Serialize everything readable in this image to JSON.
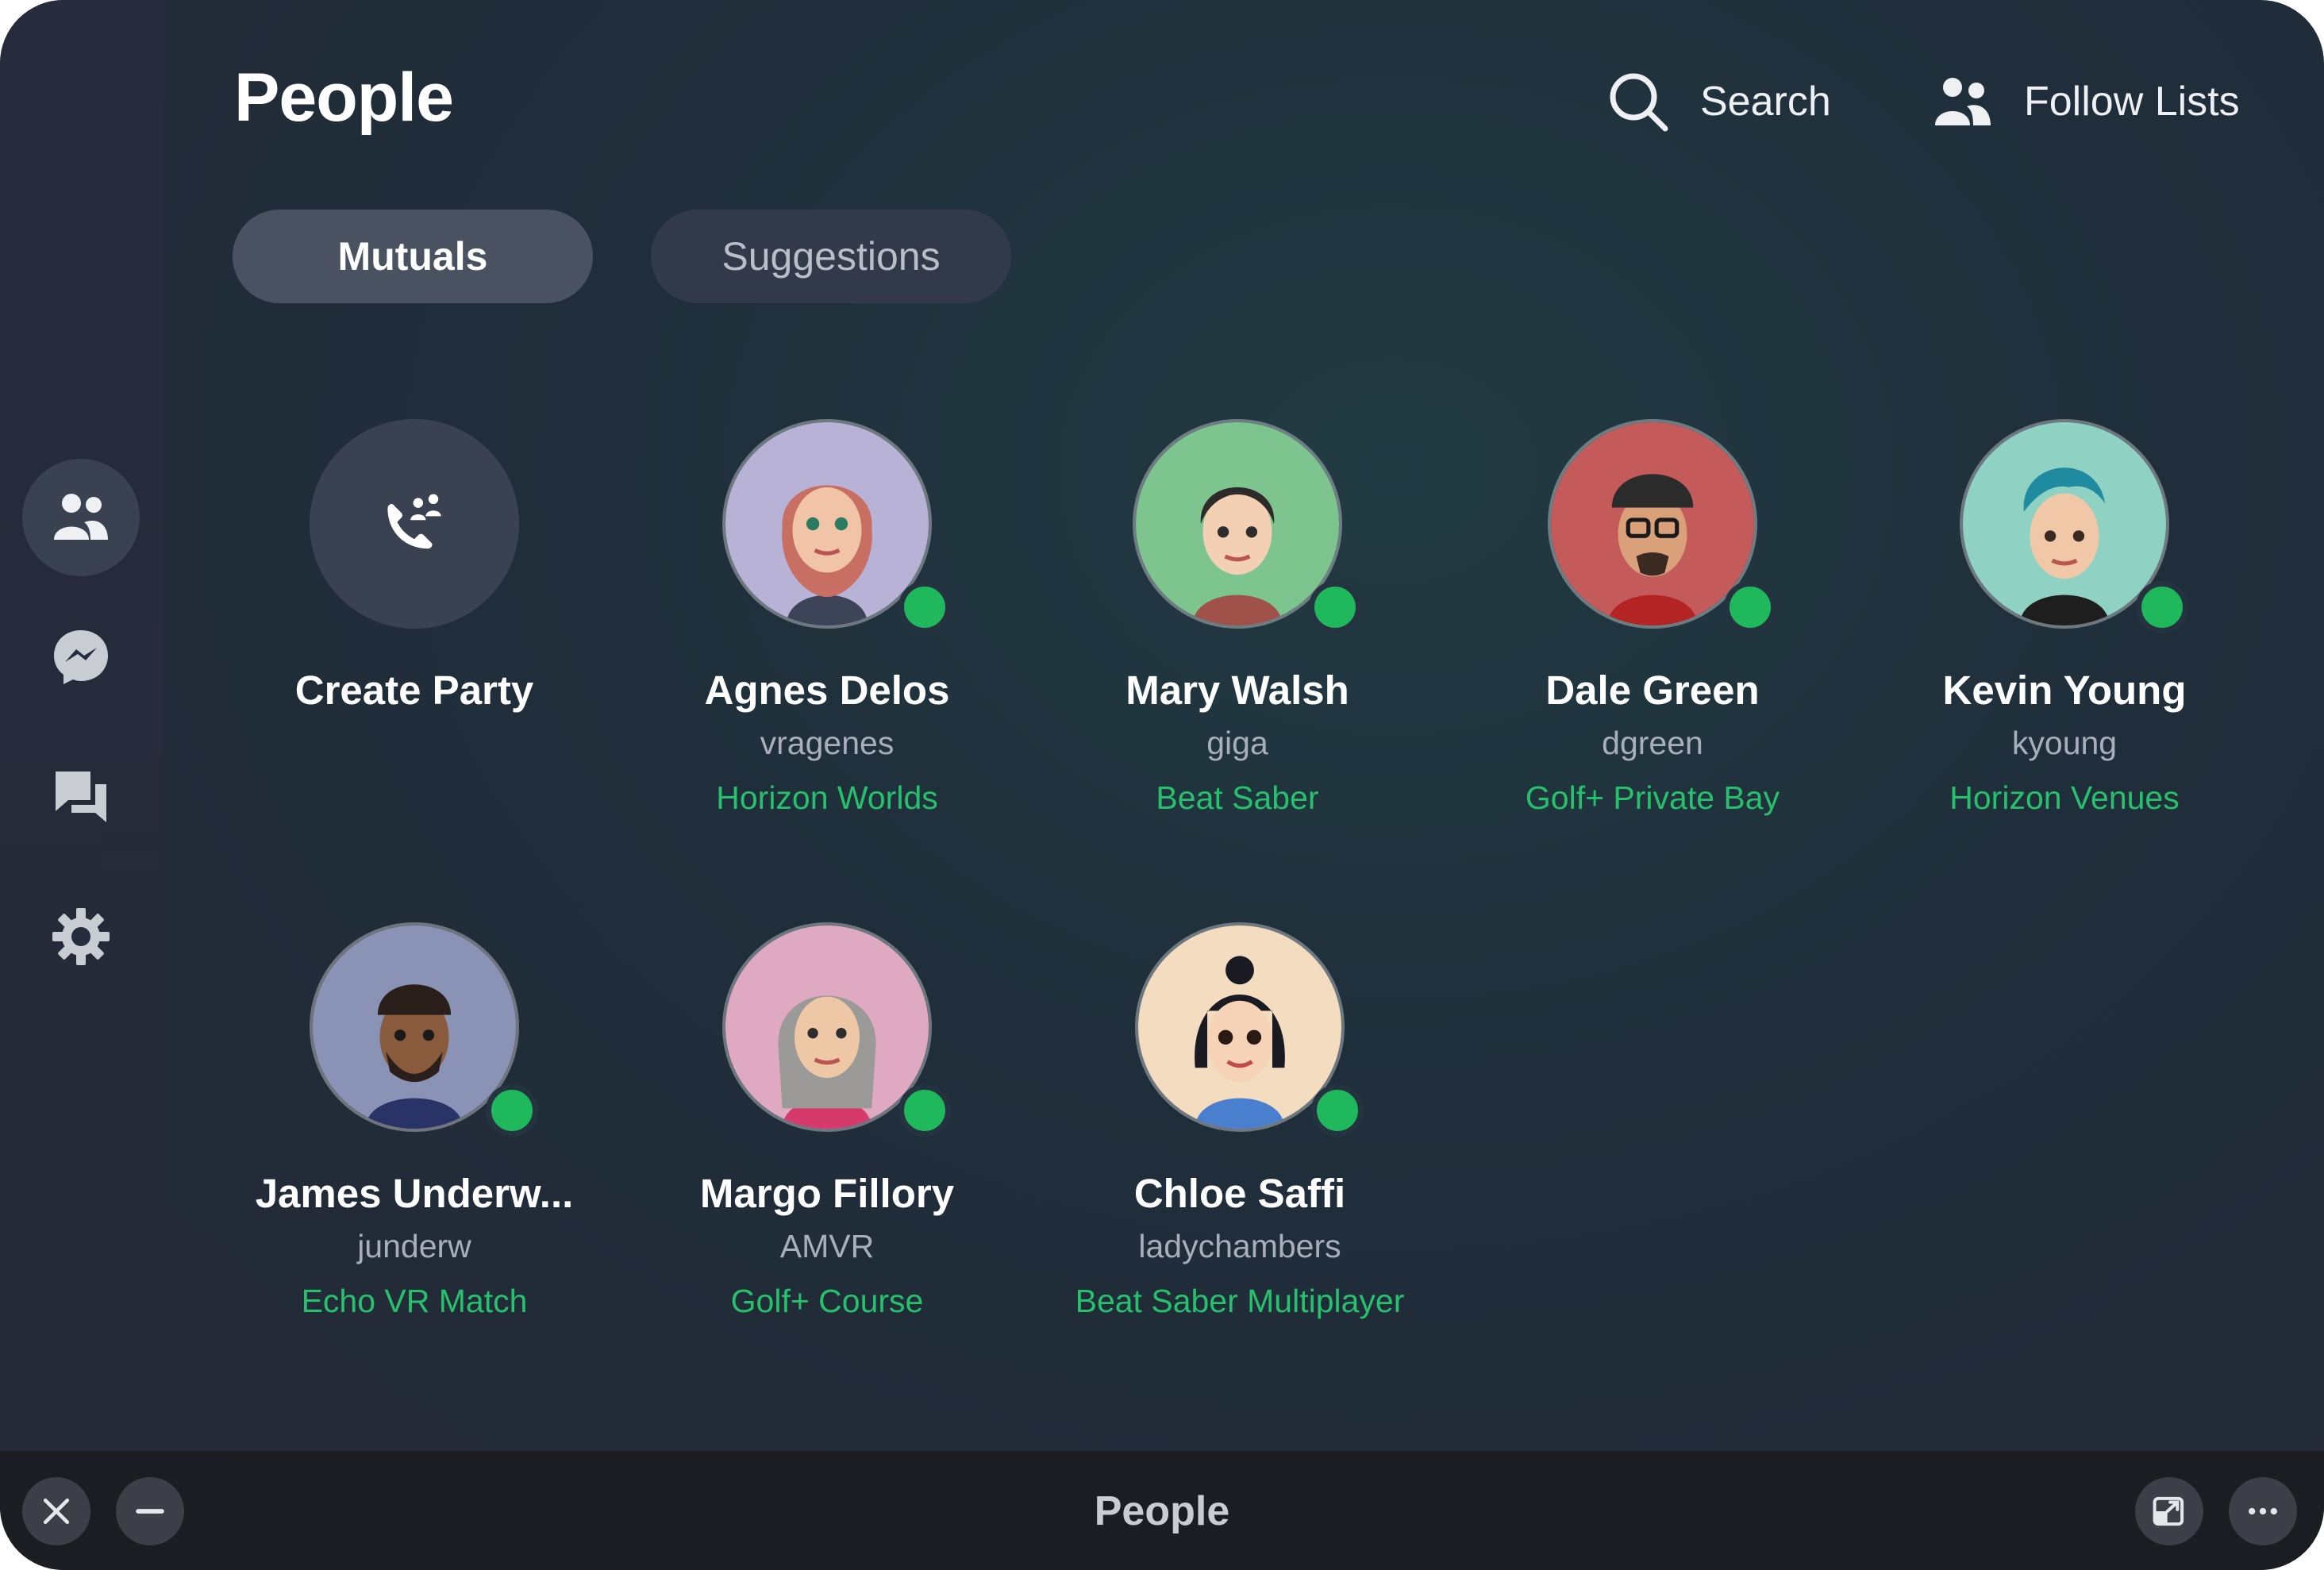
{
  "window": {
    "title": "People"
  },
  "header": {
    "title": "People",
    "search_label": "Search",
    "follow_lists_label": "Follow Lists"
  },
  "tabs": [
    {
      "label": "Mutuals",
      "active": true
    },
    {
      "label": "Suggestions",
      "active": false
    }
  ],
  "sidebar": {
    "items": [
      {
        "icon": "people-icon",
        "active": true
      },
      {
        "icon": "messenger-icon",
        "active": false
      },
      {
        "icon": "chats-icon",
        "active": false
      },
      {
        "icon": "gear-icon",
        "active": false
      }
    ]
  },
  "create_party": {
    "label": "Create Party",
    "icon": "party-call-icon"
  },
  "people": [
    {
      "name": "Agnes Delos",
      "handle": "vragenes",
      "activity": "Horizon Worlds",
      "online": true,
      "bg": "#b7b2d6"
    },
    {
      "name": "Mary Walsh",
      "handle": "giga",
      "activity": "Beat Saber",
      "online": true,
      "bg": "#7ec48f"
    },
    {
      "name": "Dale Green",
      "handle": "dgreen",
      "activity": "Golf+ Private Bay",
      "online": true,
      "bg": "#c45a5a"
    },
    {
      "name": "Kevin Young",
      "handle": "kyoung",
      "activity": "Horizon Venues",
      "online": true,
      "bg": "#8fd2c4"
    },
    {
      "name": "James Underw...",
      "handle": "junderw",
      "activity": "Echo VR Match",
      "online": true,
      "bg": "#8a93b6"
    },
    {
      "name": "Margo Fillory",
      "handle": "AMVR",
      "activity": "Golf+ Course",
      "online": true,
      "bg": "#e0a9c2"
    },
    {
      "name": "Chloe Saffi",
      "handle": "ladychambers",
      "activity": "Beat Saber Multiplayer",
      "online": true,
      "bg": "#f3dcc0"
    }
  ],
  "colors": {
    "online": "#1fb85c",
    "activity": "#27c06c",
    "active_tab": "#4a5262"
  },
  "bottom_bar": {
    "title": "People",
    "left_buttons": [
      "close-icon",
      "minimize-icon"
    ],
    "right_buttons": [
      "window-mode-icon",
      "more-icon"
    ]
  }
}
